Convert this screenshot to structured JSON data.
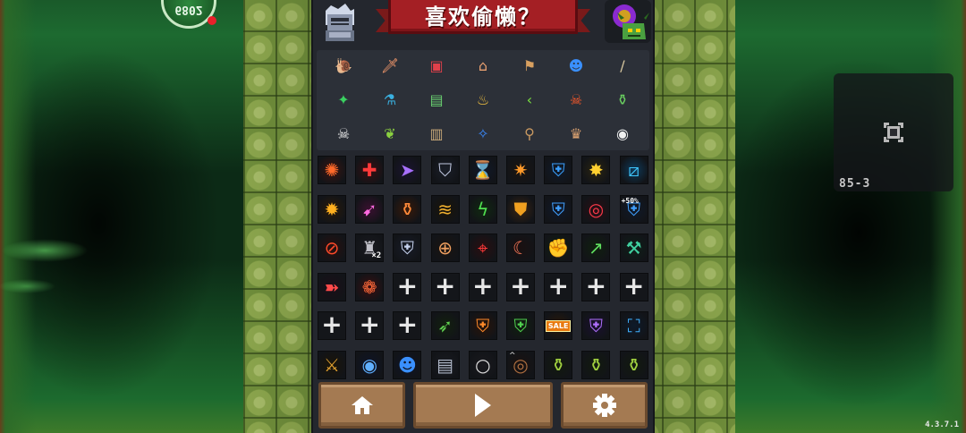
{
  "title": "喜欢偷懒？",
  "hp_value": "6802",
  "stage_code": "85-3",
  "version": "4.3.7.1",
  "items": [
    {
      "icon": "snail-shell",
      "glyph": "🐌",
      "color": "#6fb8ff"
    },
    {
      "icon": "dagger-hand",
      "glyph": "🗡",
      "color": "#ff9e6e"
    },
    {
      "icon": "circuit-chip",
      "glyph": "▣",
      "color": "#e0404a"
    },
    {
      "icon": "gate",
      "glyph": "⌂",
      "color": "#e8a070"
    },
    {
      "icon": "flag-board",
      "glyph": "⚑",
      "color": "#d8a060"
    },
    {
      "icon": "blue-head",
      "glyph": "☻",
      "color": "#3a90ff"
    },
    {
      "icon": "staff",
      "glyph": "/",
      "color": "#d8c8a0"
    },
    {
      "icon": "green-gem",
      "glyph": "✦",
      "color": "#3ad060"
    },
    {
      "icon": "blue-potion",
      "glyph": "⚗",
      "color": "#3ab0e0"
    },
    {
      "icon": "monitor",
      "glyph": "▤",
      "color": "#6ad070"
    },
    {
      "icon": "magic-lamp",
      "glyph": "♨",
      "color": "#f0c040"
    },
    {
      "icon": "green-boomerang",
      "glyph": "‹",
      "color": "#7ae040"
    },
    {
      "icon": "fire-skull",
      "glyph": "☠",
      "color": "#ff5a2a"
    },
    {
      "icon": "green-bottle",
      "glyph": "⚱",
      "color": "#6ad060"
    },
    {
      "icon": "ghost-skull",
      "glyph": "☠",
      "color": "#f0f0f0"
    },
    {
      "icon": "leaf-eye",
      "glyph": "❦",
      "color": "#8ad040"
    },
    {
      "icon": "book-case",
      "glyph": "▥",
      "color": "#c8a878"
    },
    {
      "icon": "blue-wing",
      "glyph": "✧",
      "color": "#3a8aff"
    },
    {
      "icon": "wand-key",
      "glyph": "⚲",
      "color": "#c89860"
    },
    {
      "icon": "viking-helmet",
      "glyph": "♛",
      "color": "#d8a070"
    },
    {
      "icon": "eye-card",
      "glyph": "◉",
      "color": "#f0f0f0"
    }
  ],
  "buffs": [
    {
      "icon": "fire-swirl-buff-icon",
      "glyph": "✺",
      "color": "#ff6a2a",
      "bg": "#3a1410"
    },
    {
      "icon": "health-plus-buff-icon",
      "glyph": "✚",
      "color": "#ff3a3a",
      "bg": "#3a0e10"
    },
    {
      "icon": "dash-boot-buff-icon",
      "glyph": "➤",
      "color": "#a870ff",
      "bg": "#1a1430"
    },
    {
      "icon": "shield-stripes-buff-icon",
      "glyph": "⛉",
      "color": "#c0c8e0",
      "bg": "#1a1e28"
    },
    {
      "icon": "hourglass-buff-icon",
      "glyph": "⌛",
      "color": "#60b0ff",
      "bg": "#10182a"
    },
    {
      "icon": "spark-shot-buff-icon",
      "glyph": "✷",
      "color": "#ff9a2a",
      "bg": "#1a1410"
    },
    {
      "icon": "blue-shield-buff-icon",
      "glyph": "⛨",
      "color": "#3aa0ff",
      "bg": "#101a2a"
    },
    {
      "icon": "lightning-burst-buff-icon",
      "glyph": "✸",
      "color": "#ffd030",
      "bg": "#2a2410"
    },
    {
      "icon": "ice-slash-buff-icon",
      "glyph": "⧄",
      "color": "#40c8ff",
      "bg": "#0e3a5a"
    },
    {
      "icon": "explosion-buff-icon",
      "glyph": "✹",
      "color": "#ffb020",
      "bg": "#2a1a08"
    },
    {
      "icon": "pink-arrow-buff-icon",
      "glyph": "➹",
      "color": "#ff6ae0",
      "bg": "#3a1030"
    },
    {
      "icon": "potion-frame-buff-icon",
      "glyph": "⚱",
      "color": "#ff8a3a",
      "bg": "#3a1a08"
    },
    {
      "icon": "gold-claw-buff-icon",
      "glyph": "≋",
      "color": "#f0b030",
      "bg": "#1a1408"
    },
    {
      "icon": "green-lightning-buff-icon",
      "glyph": "ϟ",
      "color": "#50e050",
      "bg": "#102a10"
    },
    {
      "icon": "gold-shield-buff-icon",
      "glyph": "⛊",
      "color": "#f0a020",
      "bg": "#3a2410"
    },
    {
      "icon": "blue-crest-buff-icon",
      "glyph": "⛨",
      "color": "#40a0ff",
      "bg": "#10182a"
    },
    {
      "icon": "red-orb-buff-icon",
      "glyph": "◎",
      "color": "#ff3a4a",
      "bg": "#2a0e14"
    },
    {
      "icon": "plus-fifty-shield-buff-icon",
      "glyph": "⛨",
      "color": "#40a0ff",
      "bg": "#101a2a",
      "label": "+50%"
    },
    {
      "icon": "red-sword-circle-buff-icon",
      "glyph": "⊘",
      "color": "#ff4a2a",
      "bg": "#2a100e"
    },
    {
      "icon": "knight-helmet-buff-icon",
      "glyph": "♜",
      "color": "#c0c0c8",
      "bg": "#1a1a20",
      "label": "×2"
    },
    {
      "icon": "silver-shield-buff-icon",
      "glyph": "⛨",
      "color": "#c8d4f0",
      "bg": "#181c28"
    },
    {
      "icon": "sword-ring-buff-icon",
      "glyph": "⊕",
      "color": "#f0a060",
      "bg": "#1a1410"
    },
    {
      "icon": "crosshair-buff-icon",
      "glyph": "⌖",
      "color": "#ff3a3a",
      "bg": "#2a0e10"
    },
    {
      "icon": "claw-slash-buff-icon",
      "glyph": "☾",
      "color": "#ff7a5a",
      "bg": "#1a1010"
    },
    {
      "icon": "green-fist-buff-icon",
      "glyph": "✊",
      "color": "#50d050",
      "bg": "#10200e"
    },
    {
      "icon": "green-spear-buff-icon",
      "glyph": "↗",
      "color": "#60e060",
      "bg": "#10200e"
    },
    {
      "icon": "green-hammer-buff-icon",
      "glyph": "⚒",
      "color": "#40d0a0",
      "bg": "#0e2018"
    },
    {
      "icon": "red-dash-buff-icon",
      "glyph": "➽",
      "color": "#ff4a4a",
      "bg": "#1a0e18"
    },
    {
      "icon": "paw-buff-icon",
      "glyph": "❁",
      "color": "#ff6a3a",
      "bg": "#3a0e10"
    },
    {
      "icon": "empty-slot-plus-icon",
      "empty": true
    },
    {
      "icon": "empty-slot-plus-icon",
      "empty": true
    },
    {
      "icon": "empty-slot-plus-icon",
      "empty": true
    },
    {
      "icon": "empty-slot-plus-icon",
      "empty": true
    },
    {
      "icon": "empty-slot-plus-icon",
      "empty": true
    },
    {
      "icon": "empty-slot-plus-icon",
      "empty": true
    },
    {
      "icon": "empty-slot-plus-icon",
      "empty": true
    },
    {
      "icon": "empty-slot-plus-icon",
      "empty": true
    },
    {
      "icon": "empty-slot-plus-icon",
      "empty": true
    },
    {
      "icon": "empty-slot-plus-icon",
      "empty": true
    },
    {
      "icon": "green-bow-buff-icon",
      "glyph": "➶",
      "color": "#60d050",
      "bg": "#12200e"
    },
    {
      "icon": "orange-shield-buff-icon",
      "glyph": "⛨",
      "color": "#ff8a2a",
      "bg": "#2a1408"
    },
    {
      "icon": "green-shield-buff-icon",
      "glyph": "⛨",
      "color": "#50d050",
      "bg": "#10200e"
    },
    {
      "icon": "sale-buff-icon",
      "sale": "SALE",
      "color": "#ff8a20",
      "bg": "#2a1808"
    },
    {
      "icon": "purple-shield-buff-icon",
      "glyph": "⛨",
      "color": "#b070ff",
      "bg": "#1a1030"
    },
    {
      "icon": "blue-frame-buff-icon",
      "glyph": "⛶",
      "color": "#40b0ff",
      "bg": "#0e1a2a"
    },
    {
      "icon": "gold-crossbow-buff-icon",
      "glyph": "⚔",
      "color": "#e0a030",
      "bg": "#1a1408"
    },
    {
      "icon": "blue-orb-buff-icon",
      "glyph": "◉",
      "color": "#60b0ff",
      "bg": "#0e1428"
    },
    {
      "icon": "blue-head-buff-icon",
      "glyph": "☻",
      "color": "#3a90ff",
      "bg": "#0e1428"
    },
    {
      "icon": "scroll-buff-icon",
      "glyph": "▤",
      "color": "#b0b8c8",
      "bg": "#1a1c22"
    },
    {
      "icon": "ring-buff-icon",
      "glyph": "○",
      "color": "#e0e0e0",
      "bg": "#1a1a1e"
    },
    {
      "icon": "target-cat-buff-icon",
      "glyph": "◎",
      "color": "#b07040",
      "bg": "#1a1210",
      "cat": true
    },
    {
      "icon": "wine-bottle-buff-icon",
      "glyph": "⚱",
      "color": "#a0d040",
      "bg": "#121a0e"
    },
    {
      "icon": "wine-bottle-buff-icon",
      "glyph": "⚱",
      "color": "#a0d040",
      "bg": "#121a0e"
    },
    {
      "icon": "wine-bottle-buff-icon",
      "glyph": "⚱",
      "color": "#a0d040",
      "bg": "#121a0e"
    }
  ],
  "buttons": [
    {
      "icon": "home-icon"
    },
    {
      "icon": "play-icon"
    },
    {
      "icon": "gear-icon"
    }
  ]
}
